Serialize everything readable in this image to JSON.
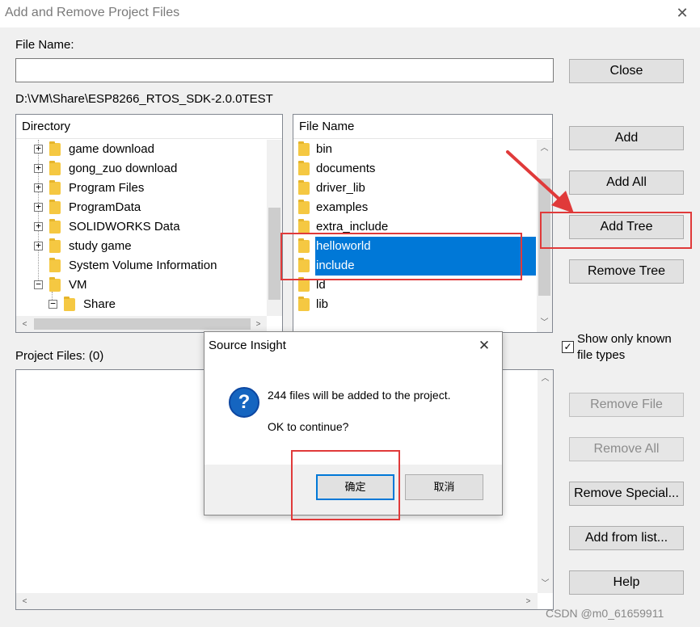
{
  "window": {
    "title": "Add and Remove Project Files",
    "close_glyph": "✕"
  },
  "file_name": {
    "label": "File Name:",
    "value": ""
  },
  "current_path": "D:\\VM\\Share\\ESP8266_RTOS_SDK-2.0.0TEST",
  "directory": {
    "header": "Directory",
    "items": [
      {
        "label": "game download",
        "expander": "+"
      },
      {
        "label": "gong_zuo download",
        "expander": "+"
      },
      {
        "label": "Program Files",
        "expander": "+"
      },
      {
        "label": "ProgramData",
        "expander": "+"
      },
      {
        "label": "SOLIDWORKS Data",
        "expander": "+"
      },
      {
        "label": "study game",
        "expander": "+"
      },
      {
        "label": "System Volume Information",
        "expander": ""
      },
      {
        "label": "VM",
        "expander": "−"
      },
      {
        "label": "Share",
        "expander": "−"
      }
    ]
  },
  "files": {
    "header": "File Name",
    "items": [
      {
        "label": "bin"
      },
      {
        "label": "documents"
      },
      {
        "label": "driver_lib"
      },
      {
        "label": "examples"
      },
      {
        "label": "extra_include"
      },
      {
        "label": "helloworld",
        "selected": true
      },
      {
        "label": "include",
        "selected": true
      },
      {
        "label": "ld"
      },
      {
        "label": "lib"
      }
    ]
  },
  "buttons": {
    "close": "Close",
    "add": "Add",
    "add_all": "Add All",
    "add_tree": "Add Tree",
    "remove_tree": "Remove Tree",
    "remove_file": "Remove File",
    "remove_all": "Remove All",
    "remove_special": "Remove Special...",
    "add_from_list": "Add from list...",
    "help": "Help"
  },
  "show_known": {
    "label_line1": "Show only known",
    "label_line2": "file types",
    "checked": true,
    "check_glyph": "✓"
  },
  "project_files": {
    "label": "Project Files: (0)"
  },
  "dialog": {
    "title": "Source Insight",
    "close_glyph": "✕",
    "icon_glyph": "?",
    "message": "244 files will be added to the project.",
    "question": "OK to continue?",
    "ok": "确定",
    "cancel": "取消"
  },
  "scroll_glyphs": {
    "up": "︿",
    "down": "﹀",
    "left": "<",
    "right": ">"
  },
  "watermark": "CSDN @m0_61659911",
  "colors": {
    "selection": "#0078d7",
    "annotation": "#e03a3a",
    "dialog_icon": "#1565c0"
  }
}
